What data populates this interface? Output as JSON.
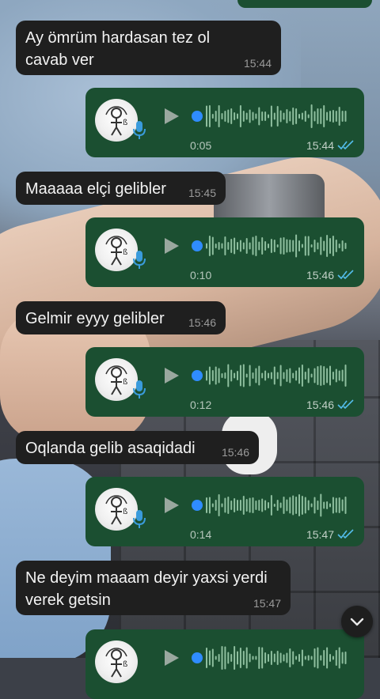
{
  "colors": {
    "incoming_bubble": "#1f1f1f",
    "outgoing_bubble": "#1b4f31",
    "read_ticks": "#53bdeb",
    "progress_dot": "#2f8cff",
    "waveform": "#8fbf9f"
  },
  "messages": [
    {
      "type": "text",
      "direction": "in",
      "text": "Ay ömrüm hardasan tez ol cavab ver",
      "time": "15:44"
    },
    {
      "type": "voice",
      "direction": "out",
      "duration": "0:05",
      "time": "15:44",
      "status": "read",
      "icons": [
        "avatar",
        "mic-icon",
        "play-icon",
        "read-ticks-icon"
      ]
    },
    {
      "type": "text",
      "direction": "in",
      "text": "Maaaaa elçi gelibler",
      "time": "15:45"
    },
    {
      "type": "voice",
      "direction": "out",
      "duration": "0:10",
      "time": "15:46",
      "status": "read"
    },
    {
      "type": "text",
      "direction": "in",
      "text": "Gelmir eyyy gelibler",
      "time": "15:46"
    },
    {
      "type": "voice",
      "direction": "out",
      "duration": "0:12",
      "time": "15:46",
      "status": "read"
    },
    {
      "type": "text",
      "direction": "in",
      "text": "Oqlanda gelib asaqidadi",
      "time": "15:46"
    },
    {
      "type": "voice",
      "direction": "out",
      "duration": "0:14",
      "time": "15:47",
      "status": "read"
    },
    {
      "type": "text",
      "direction": "in",
      "text": "Ne deyim maaam deyir yaxsi yerdi verek getsin",
      "time": "15:47"
    },
    {
      "type": "voice",
      "direction": "out",
      "duration": "",
      "time": "",
      "status": "read"
    }
  ],
  "scroll_button": {
    "icon": "chevron-down-icon"
  }
}
